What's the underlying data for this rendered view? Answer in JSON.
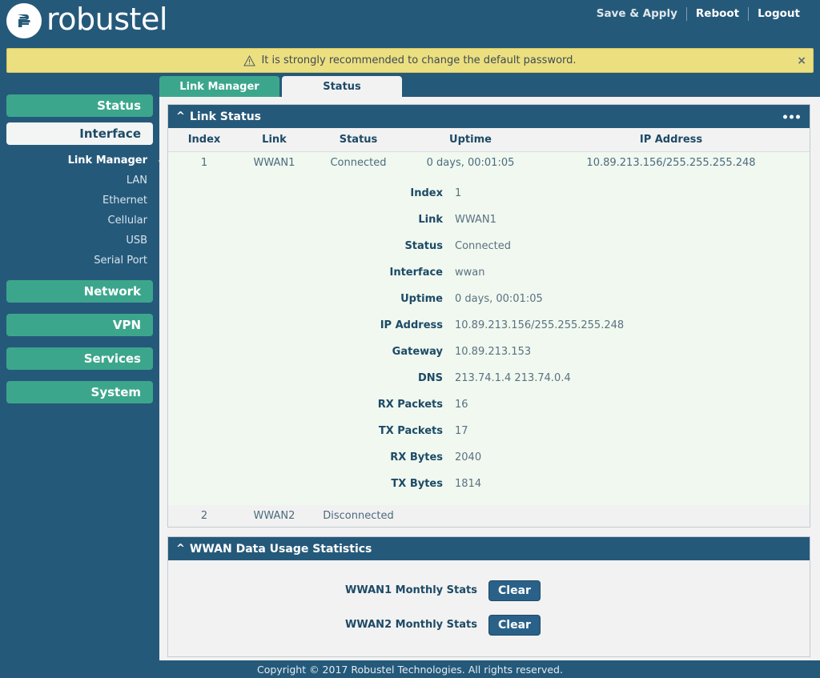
{
  "brand": {
    "name": "robustel",
    "logo_icon": "robustel-logo-icon"
  },
  "header": {
    "save_apply": "Save & Apply",
    "reboot": "Reboot",
    "logout": "Logout"
  },
  "banner": {
    "warning_icon": "warning-triangle-icon",
    "message": "It is strongly recommended to change the default password.",
    "close": "×"
  },
  "sidebar": {
    "groups": [
      {
        "label": "Status",
        "active": false
      },
      {
        "label": "Interface",
        "active": true
      },
      {
        "label": "Network",
        "active": false
      },
      {
        "label": "VPN",
        "active": false
      },
      {
        "label": "Services",
        "active": false
      },
      {
        "label": "System",
        "active": false
      }
    ],
    "interface_items": [
      {
        "label": "Link Manager",
        "selected": true
      },
      {
        "label": "LAN",
        "selected": false
      },
      {
        "label": "Ethernet",
        "selected": false
      },
      {
        "label": "Cellular",
        "selected": false
      },
      {
        "label": "USB",
        "selected": false
      },
      {
        "label": "Serial Port",
        "selected": false
      }
    ]
  },
  "tabs": [
    {
      "label": "Link Manager",
      "active": false,
      "style": "green"
    },
    {
      "label": "Status",
      "active": true,
      "style": "white"
    }
  ],
  "link_status_panel": {
    "title": "Link Status",
    "collapse_icon": "chevron-up-icon",
    "menu_icon": "ellipsis-icon",
    "columns": [
      "Index",
      "Link",
      "Status",
      "Uptime",
      "IP Address"
    ],
    "rows": [
      {
        "index": "1",
        "link": "WWAN1",
        "status": "Connected",
        "uptime": "0 days, 00:01:05",
        "ip_address": "10.89.213.156/255.255.255.248"
      },
      {
        "index": "2",
        "link": "WWAN2",
        "status": "Disconnected",
        "uptime": "",
        "ip_address": ""
      }
    ],
    "detail": [
      {
        "label": "Index",
        "value": "1"
      },
      {
        "label": "Link",
        "value": "WWAN1"
      },
      {
        "label": "Status",
        "value": "Connected"
      },
      {
        "label": "Interface",
        "value": "wwan"
      },
      {
        "label": "Uptime",
        "value": "0 days, 00:01:05"
      },
      {
        "label": "IP Address",
        "value": "10.89.213.156/255.255.255.248"
      },
      {
        "label": "Gateway",
        "value": "10.89.213.153"
      },
      {
        "label": "DNS",
        "value": "213.74.1.4 213.74.0.4"
      },
      {
        "label": "RX Packets",
        "value": "16"
      },
      {
        "label": "TX Packets",
        "value": "17"
      },
      {
        "label": "RX Bytes",
        "value": "2040"
      },
      {
        "label": "TX Bytes",
        "value": "1814"
      }
    ]
  },
  "usage_panel": {
    "title": "WWAN Data Usage Statistics",
    "collapse_icon": "chevron-up-icon",
    "rows": [
      {
        "label": "WWAN1 Monthly Stats",
        "button": "Clear"
      },
      {
        "label": "WWAN2 Monthly Stats",
        "button": "Clear"
      }
    ]
  },
  "footer": {
    "copyright": "Copyright © 2017 Robustel Technologies. All rights reserved."
  },
  "colors": {
    "header_blue": "#25597a",
    "accent_teal": "#3ca68c",
    "banner_yellow": "#ecdf80",
    "detail_bg": "#f0f8f0",
    "panel_bg": "#f2f2f2",
    "button_blue": "#2a6188"
  }
}
